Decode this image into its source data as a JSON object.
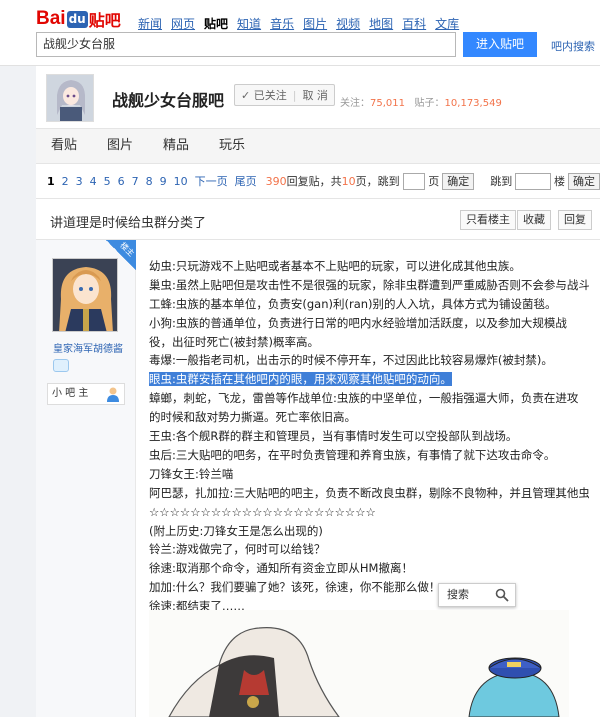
{
  "header": {
    "logo_bai": "Bai",
    "logo_du": "du",
    "logo_tieba": "贴吧",
    "nav": [
      "新闻",
      "网页",
      "贴吧",
      "知道",
      "音乐",
      "图片",
      "视频",
      "地图",
      "百科",
      "文库"
    ],
    "nav_active": "贴吧",
    "search_value": "战舰少女台服",
    "search_button": "进入贴吧",
    "in_forum_search": "吧内搜索"
  },
  "forum": {
    "name": "战舰少女台服吧",
    "follow_status": "已关注",
    "unfollow": "取 消",
    "follow_label": "关注：",
    "follow_count": "75,011",
    "post_label": "贴子：",
    "post_count": "10,173,549"
  },
  "tabs": [
    "看贴",
    "图片",
    "精品",
    "玩乐"
  ],
  "pager": {
    "pages": [
      "1",
      "2",
      "3",
      "4",
      "5",
      "6",
      "7",
      "8",
      "9",
      "10"
    ],
    "current": "1",
    "next": "下一页",
    "last": "尾页",
    "reply_count": "390",
    "reply_suffix": "回复贴，共",
    "page_count": "10",
    "page_suffix": "页，跳到",
    "page_unit": "页",
    "confirm": "确定",
    "jump_label": "跳到",
    "floor_unit": "楼",
    "confirm2": "确定"
  },
  "thread": {
    "title": "讲道理是时候给虫群分类了",
    "only_op": "只看楼主",
    "favorite": "收藏",
    "reply": "回复"
  },
  "author": {
    "badge": "楼主",
    "name": "皇家海军胡德酱",
    "role": "小 吧 主"
  },
  "search_popup": "搜索",
  "content": [
    "幼虫:只玩游戏不上贴吧或者基本不上贴吧的玩家，可以进化成其他虫族。",
    "巢虫:虽然上贴吧但是攻击性不是很强的玩家，除非虫群遭到严重威胁否则不会参与战斗。",
    "工蜂:虫族的基本单位，负责安(gan)利(ran)别的人入坑，具体方式为铺设菌毯。",
    "小狗:虫族的普通单位，负责进行日常的吧内水经验增加活跃度，以及参加大规模战役，出征时死亡(被封禁)概率高。",
    "毒爆:一般指老司机，出击示的时候不停开车，不过因此比较容易爆炸(被封禁)。",
    "眼虫:虫群安插在其他吧内的眼，用来观察其他贴吧的动向。",
    "蟑螂，刺蛇，飞龙，雷兽等作战单位:虫族的中坚单位，一般指强逼大师，负责在进攻的时候和敌对势力撕逼。死亡率依旧高。",
    "王虫:各个舰R群的群主和管理员，当有事情时发生可以空投部队到战场。",
    "虫后:三大贴吧的吧务，在平时负责管理和养育虫族，有事情了就下达攻击命令。",
    "刀锋女王:铃兰喵",
    "阿巴瑟，扎加拉:三大贴吧的吧主，负责不断改良虫群，剔除不良物种，并且管理其他虫后。",
    "☆☆☆☆☆☆☆☆☆☆☆☆☆☆☆☆☆☆☆☆☆☆",
    "(附上历史:刀锋女王是怎么出现的)",
    "铃兰:游戏做完了，何时可以给钱？",
    "徐速:取消那个命令，通知所有资金立即从HM撤离！",
    "加加:什么？我们要骗了她？该死，徐速，你不能那么做！",
    "徐速:都结束了……"
  ]
}
